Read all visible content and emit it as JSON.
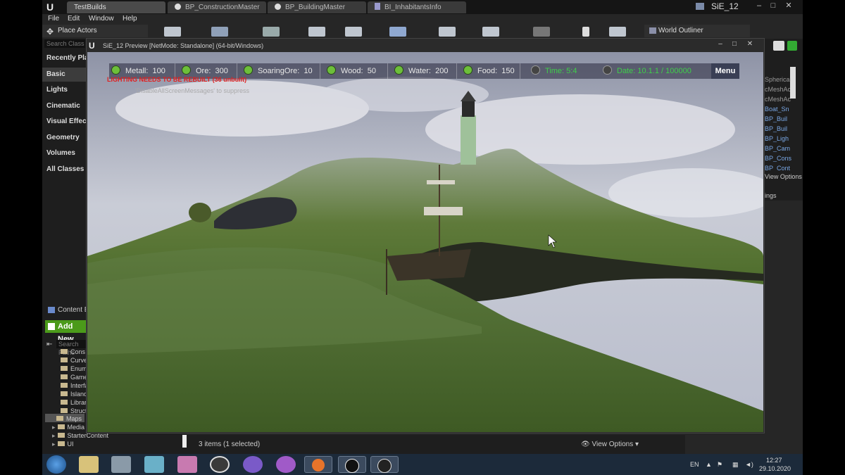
{
  "titlebar": {
    "tabs": [
      {
        "label": "TestBuilds"
      },
      {
        "label": "BP_ConstructionMaster"
      },
      {
        "label": "BP_BuildingMaster"
      },
      {
        "label": "BI_InhabitantsInfo"
      }
    ],
    "project_name": "SiE_12"
  },
  "menu": {
    "items": [
      "File",
      "Edit",
      "Window",
      "Help"
    ]
  },
  "toolbar": {
    "place_actors": "Place Actors",
    "world_outliner": "World Outliner"
  },
  "place_panel": {
    "search_placeholder": "Search Class",
    "categories": [
      "Recently Placed",
      "Basic",
      "Lights",
      "Cinematic",
      "Visual Effects",
      "Geometry",
      "Volumes",
      "All Classes"
    ],
    "selected": "Basic"
  },
  "outliner": {
    "items": [
      "SphericalF",
      "cMeshAc",
      "cMeshAc",
      "Boat_Sn",
      "BP_Buil",
      "BP_Buil",
      "BP_Ligh",
      "BP_Cam",
      "BP_Cons",
      "BP_Cont"
    ],
    "view_options": "View Options",
    "settings_partial": "ings"
  },
  "content_browser": {
    "title": "Content Browser",
    "add_new": "Add New",
    "search_placeholder": "Search Paths",
    "folders": [
      "Cons",
      "Curves",
      "Enums",
      "Game",
      "Interface",
      "Islands",
      "Library",
      "Structs",
      "Maps",
      "Media",
      "StarterContent",
      "UI"
    ],
    "status": "3 items (1 selected)",
    "view_options": "View Options"
  },
  "preview": {
    "title": "SiE_12 Preview [NetMode: Standalone] (64-bit/Windows)",
    "warning": "LIGHTING NEEDS TO BE REBUILT (36 unbuilt)",
    "warning_hint": "'DisableAllScreenMessages' to suppress"
  },
  "hud": {
    "resources": [
      {
        "label": "Metall:",
        "value": "100"
      },
      {
        "label": "Ore:",
        "value": "300"
      },
      {
        "label": "SoaringOre:",
        "value": "10"
      },
      {
        "label": "Wood:",
        "value": "50"
      },
      {
        "label": "Water:",
        "value": "200"
      },
      {
        "label": "Food:",
        "value": "150"
      }
    ],
    "time": "Time: 5:4",
    "date": "Date: 10.1.1 / 100000",
    "menu": "Menu"
  },
  "taskbar": {
    "lang": "EN",
    "time": "12:27",
    "date": "29.10.2020"
  },
  "colors": {
    "accent_green": "#4b9a1a",
    "hud_text_green": "#3fd04a",
    "warning_red": "#e02020"
  }
}
